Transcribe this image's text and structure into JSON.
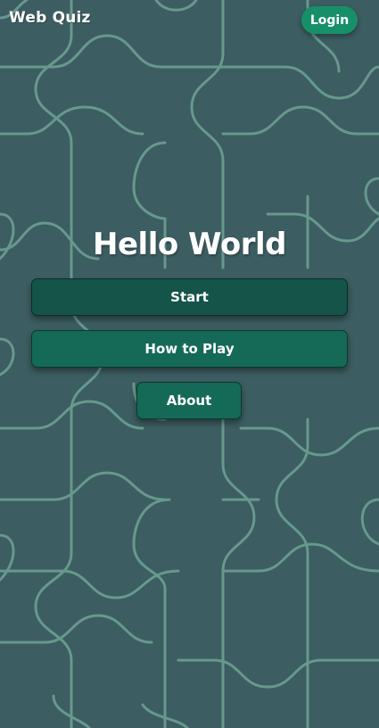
{
  "header": {
    "brand": "Web Quiz",
    "login_label": "Login"
  },
  "main": {
    "title": "Hello World",
    "buttons": {
      "start": "Start",
      "how_to_play": "How to Play",
      "about": "About"
    }
  },
  "colors": {
    "background": "#3c5d61",
    "puzzle_lines": "#6fa395",
    "login": "#179069",
    "start": "#155448",
    "menu": "#146a57"
  }
}
